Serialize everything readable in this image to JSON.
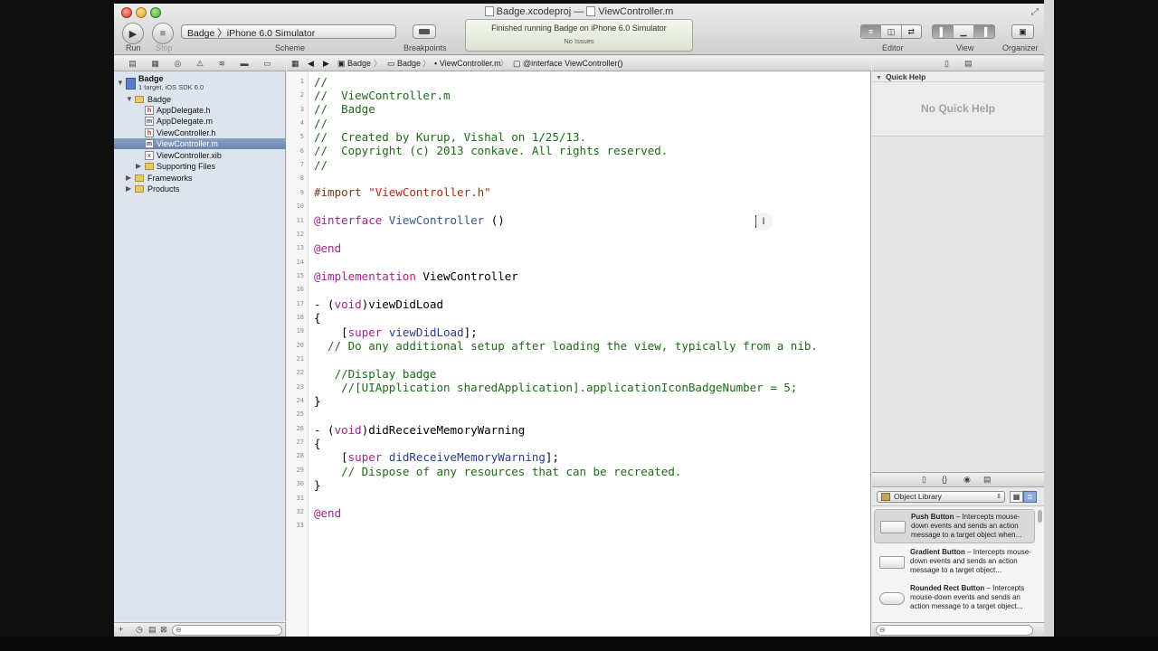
{
  "window": {
    "title_project": "Badge.xcodeproj",
    "title_separator": "—",
    "title_file": "ViewController.m"
  },
  "toolbar": {
    "run_label": "Run",
    "stop_label": "Stop",
    "scheme": "Badge  〉iPhone 6.0 Simulator",
    "scheme_label": "Scheme",
    "breakpoints_label": "Breakpoints",
    "activity_status": "Finished running Badge on iPhone 6.0 Simulator",
    "activity_issues": "No Issues",
    "editor_label": "Editor",
    "view_label": "View",
    "organizer_label": "Organizer"
  },
  "navigator": {
    "project_name": "Badge",
    "project_subtitle": "1 target, iOS SDK 6.0",
    "items": [
      {
        "label": "Badge",
        "icon": "folder"
      },
      {
        "label": "AppDelegate.h",
        "icon": "h"
      },
      {
        "label": "AppDelegate.m",
        "icon": "m"
      },
      {
        "label": "ViewController.h",
        "icon": "h"
      },
      {
        "label": "ViewController.m",
        "icon": "m"
      },
      {
        "label": "ViewController.xib",
        "icon": "xib"
      },
      {
        "label": "Supporting Files",
        "icon": "folder"
      },
      {
        "label": "Frameworks",
        "icon": "folder"
      },
      {
        "label": "Products",
        "icon": "folder"
      }
    ]
  },
  "jumpbar": {
    "items": [
      "Badge",
      "Badge",
      "ViewController.m",
      "@interface ViewController()"
    ]
  },
  "editor": {
    "line_numbers": [
      "1",
      "2",
      "3",
      "4",
      "5",
      "6",
      "7",
      "8",
      "9",
      "10",
      "11",
      "12",
      "13",
      "14",
      "15",
      "16",
      "17",
      "18",
      "19",
      "20",
      "21",
      "22",
      "23",
      "24",
      "25",
      "26",
      "27",
      "28",
      "29",
      "30",
      "31",
      "32",
      "33"
    ],
    "lines": {
      "l1": "//",
      "l2": "//  ViewController.m",
      "l3": "//  Badge",
      "l4": "//",
      "l5": "//  Created by Kurup, Vishal on 1/25/13.",
      "l6": "//  Copyright (c) 2013 conkave. All rights reserved.",
      "l7": "//",
      "l9_pre": "#import ",
      "l9_str": "\"ViewController.h\"",
      "l11_kw": "@interface ",
      "l11_cls": "ViewController ",
      "l11_rest": "()",
      "l13": "@end",
      "l15_kw": "@implementation ",
      "l15_rest": "ViewController",
      "l17_a": "- (",
      "l17_kw": "void",
      "l17_b": ")viewDidLoad",
      "l18": "{",
      "l19_a": "    [",
      "l19_kw": "super",
      "l19_sp": " ",
      "l19_m": "viewDidLoad",
      "l19_b": "];",
      "l20": "  // Do any additional setup after loading the view, typically from a nib.",
      "l22": "   //Display badge",
      "l23": "    //[UIApplication sharedApplication].applicationIconBadgeNumber = 5;",
      "l24": "}",
      "l26_a": "- (",
      "l26_kw": "void",
      "l26_b": ")didReceiveMemoryWarning",
      "l27": "{",
      "l28_a": "    [",
      "l28_kw": "super",
      "l28_sp": " ",
      "l28_m": "didReceiveMemoryWarning",
      "l28_b": "];",
      "l29": "    // Dispose of any resources that can be recreated.",
      "l30": "}",
      "l32": "@end"
    }
  },
  "utilities": {
    "quick_help_title": "Quick Help",
    "no_quick_help": "No Quick Help",
    "library_popup": "Object Library",
    "library_items": [
      {
        "name": "Push Button",
        "desc": " – Intercepts mouse-down events and sends an action message to a target object when..."
      },
      {
        "name": "Gradient Button",
        "desc": " – Intercepts mouse-down events and sends an action message to a target object..."
      },
      {
        "name": "Rounded Rect Button",
        "desc": " – Intercepts mouse-down events and sends an action message to a target object..."
      }
    ]
  },
  "colors": {
    "comment": "#1d6a18",
    "keyword": "#a6208f",
    "string": "#b0251b",
    "preprocessor": "#6b3a1e",
    "class": "#36578c",
    "selection": "#6d86b2"
  }
}
